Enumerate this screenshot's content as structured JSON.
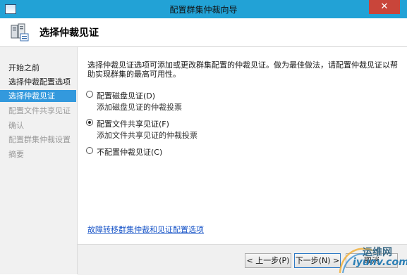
{
  "window": {
    "title": "配置群集仲裁向导",
    "close_glyph": "✕"
  },
  "header": {
    "title": "选择仲裁见证",
    "icon": "cluster-wizard-icon"
  },
  "nav": {
    "items": [
      {
        "label": "开始之前",
        "state": "normal"
      },
      {
        "label": "选择仲裁配置选项",
        "state": "normal"
      },
      {
        "label": "选择仲裁见证",
        "state": "active"
      },
      {
        "label": "配置文件共享见证",
        "state": "disabled"
      },
      {
        "label": "确认",
        "state": "disabled"
      },
      {
        "label": "配置群集仲裁设置",
        "state": "disabled"
      },
      {
        "label": "摘要",
        "state": "disabled"
      }
    ]
  },
  "main": {
    "description": "选择仲裁见证选项可添加或更改群集配置的仲裁见证。做为最佳做法，请配置仲裁见证以帮助实现群集的最高可用性。",
    "options": [
      {
        "label": "配置磁盘见证(D)",
        "description": "添加磁盘见证的仲裁投票",
        "checked": false
      },
      {
        "label": "配置文件共享见证(F)",
        "description": "添加文件共享见证的仲裁投票",
        "checked": true
      },
      {
        "label": "不配置仲裁见证(C)",
        "description": "",
        "checked": false
      }
    ],
    "help_link": "故障转移群集仲裁和见证配置选项"
  },
  "buttons": {
    "back": "< 上一步(P)",
    "next": "下一步(N) >",
    "cancel": "取消"
  },
  "watermark": {
    "line1": "运维网",
    "line2": "iyunv.com"
  },
  "colors": {
    "titlebar": "#22a2d6",
    "active_nav": "#3399dd",
    "close": "#c9453a",
    "link": "#1a56c8"
  }
}
